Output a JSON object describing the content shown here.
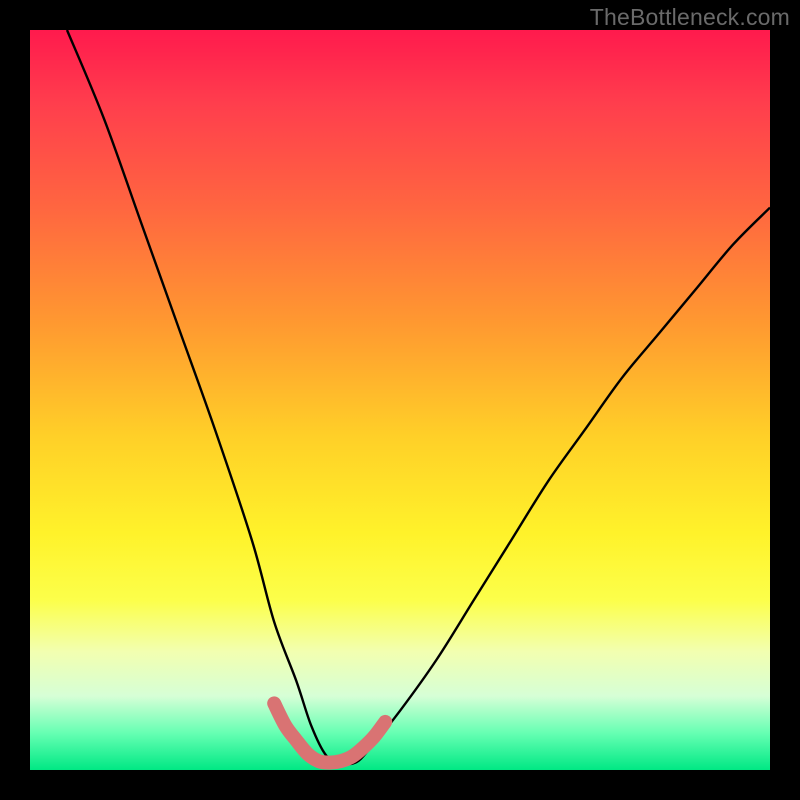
{
  "watermark": "TheBottleneck.com",
  "chart_data": {
    "type": "line",
    "title": "",
    "xlabel": "",
    "ylabel": "",
    "xlim": [
      0,
      100
    ],
    "ylim": [
      0,
      100
    ],
    "series": [
      {
        "name": "bottleneck-curve",
        "x": [
          5,
          10,
          15,
          20,
          25,
          30,
          33,
          36,
          38,
          40,
          42,
          44,
          46,
          50,
          55,
          60,
          65,
          70,
          75,
          80,
          85,
          90,
          95,
          100
        ],
        "values": [
          100,
          88,
          74,
          60,
          46,
          31,
          20,
          12,
          6,
          2,
          1,
          1,
          3,
          8,
          15,
          23,
          31,
          39,
          46,
          53,
          59,
          65,
          71,
          76
        ]
      },
      {
        "name": "highlight-u",
        "x": [
          33,
          34.5,
          36,
          37.5,
          39,
          40.5,
          42,
          43.5,
          45,
          46.5,
          48
        ],
        "values": [
          9,
          6,
          4,
          2.2,
          1.2,
          1,
          1.2,
          1.8,
          3,
          4.5,
          6.5
        ]
      }
    ],
    "gradient_stops": [
      {
        "pos": 0,
        "color": "#ff1a4d"
      },
      {
        "pos": 24,
        "color": "#ff6640"
      },
      {
        "pos": 55,
        "color": "#ffd028"
      },
      {
        "pos": 77,
        "color": "#fcff4a"
      },
      {
        "pos": 95,
        "color": "#66ffb3"
      },
      {
        "pos": 100,
        "color": "#00e884"
      }
    ],
    "highlight_color": "#d97373",
    "curve_color": "#000000"
  }
}
